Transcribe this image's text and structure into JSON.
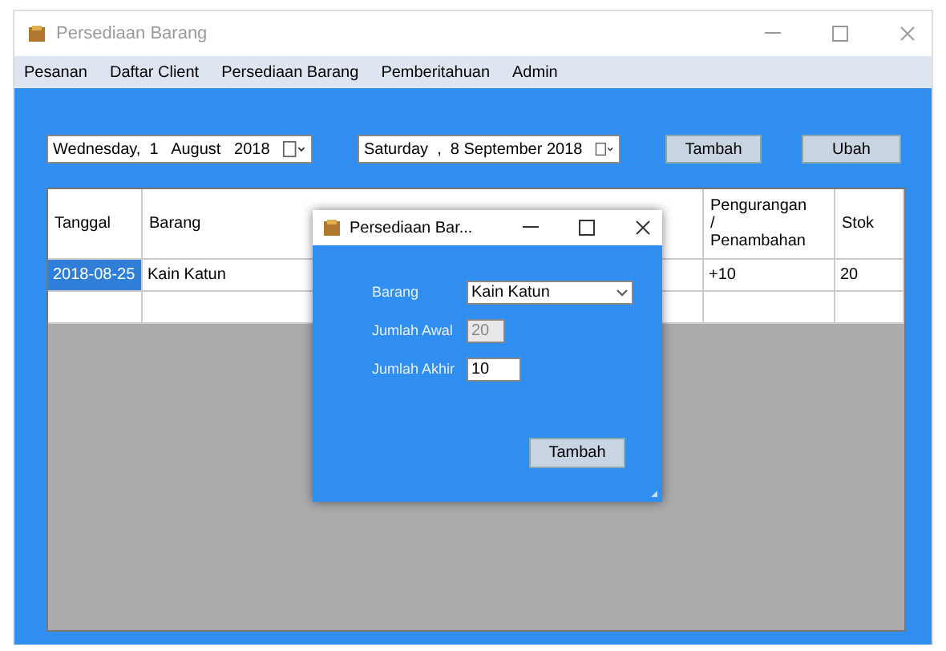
{
  "window": {
    "title": "Persediaan Barang"
  },
  "menu": [
    "Pesanan",
    "Daftar Client",
    "Persediaan Barang",
    "Pemberitahuan",
    "Admin"
  ],
  "filters": {
    "date_from": "Wednesday,  1   August   2018",
    "date_to": "Saturday  ,  8 September 2018"
  },
  "buttons": [
    "Tambah",
    "Ubah"
  ],
  "table": {
    "columns": [
      "Tanggal",
      "Barang",
      "Pengurangan / Penambahan",
      "Stok"
    ],
    "rows": [
      {
        "cells": [
          {
            "text": "2018-08-25",
            "selected": true
          },
          {
            "text": "Kain Katun",
            "selected": false
          },
          {
            "text": "+10",
            "selected": false
          },
          {
            "text": "20",
            "selected": false
          }
        ]
      }
    ]
  },
  "dialog": {
    "title": "Persediaan Bar...",
    "fields": [
      {
        "kind": "combo",
        "label": "Barang",
        "value": "Kain Katun",
        "disabled": false
      },
      {
        "kind": "text",
        "label": "Jumlah Awal",
        "value": "20",
        "disabled": true
      },
      {
        "kind": "text",
        "label": "Jumlah Akhir",
        "value": "10",
        "disabled": false
      }
    ],
    "button": "Tambah"
  }
}
